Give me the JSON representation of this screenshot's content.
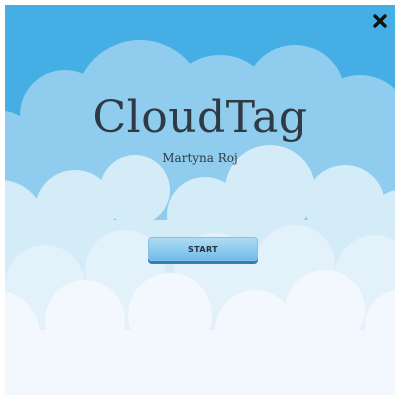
{
  "game": {
    "title": "CloudTag",
    "author": "Martyna Roj",
    "start_label": "START"
  },
  "icons": {
    "close": "close-icon"
  },
  "colors": {
    "sky": "#45aee4",
    "cloud_back": "#8fccee",
    "cloud_mid": "#d4ebf8",
    "cloud_front": "#f2f8fd",
    "text": "#2f3a45",
    "button": "#8ccbee"
  }
}
